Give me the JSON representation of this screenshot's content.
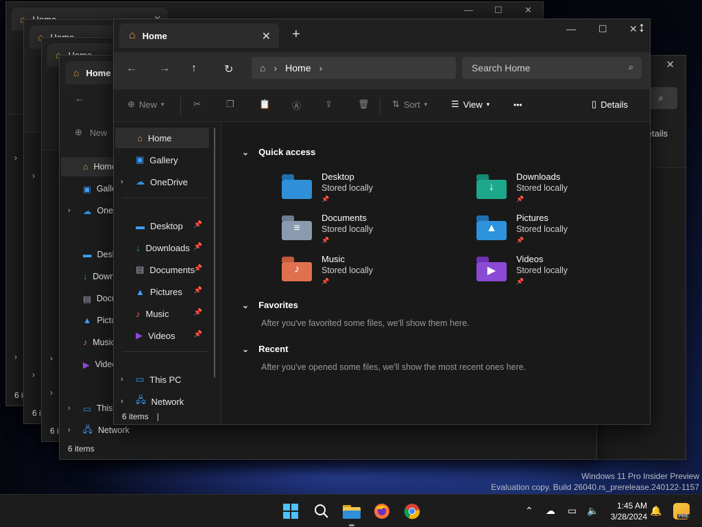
{
  "desktop": {
    "watermark_line1": "Windows 11 Pro Insider Preview",
    "watermark_line2": "Evaluation copy. Build 26040.rs_prerelease.240122-1157"
  },
  "background_windows": [
    {
      "tab_title": "Home",
      "status": "6 items"
    },
    {
      "tab_title": "Home",
      "status": "6 items"
    },
    {
      "tab_title": "Home",
      "status": "6 items"
    },
    {
      "tab_title": "Home",
      "status": "6 items",
      "new_label": "New",
      "nav": [
        "Home",
        "Gallery",
        "OneDrive",
        "Desktop",
        "Downloads",
        "Documents",
        "Pictures",
        "Music",
        "Videos",
        "This PC",
        "Network"
      ]
    }
  ],
  "main": {
    "tab_title": "Home",
    "breadcrumb": [
      "Home"
    ],
    "search_placeholder": "Search Home",
    "commands": {
      "new": "New",
      "sort": "Sort",
      "view": "View",
      "more": "•••",
      "details": "Details"
    },
    "nav": {
      "home": "Home",
      "gallery": "Gallery",
      "onedrive": "OneDrive",
      "desktop": "Desktop",
      "downloads": "Downloads",
      "documents": "Documents",
      "pictures": "Pictures",
      "music": "Music",
      "videos": "Videos",
      "thispc": "This PC",
      "network": "Network"
    },
    "status": "6 items",
    "sections": {
      "quick_access": "Quick access",
      "favorites": "Favorites",
      "favorites_empty": "After you've favorited some files, we'll show them here.",
      "recent": "Recent",
      "recent_empty": "After you've opened some files, we'll show the most recent ones here."
    },
    "quick_access": [
      {
        "name": "Desktop",
        "sub": "Stored locally",
        "color": "#2f8fd8"
      },
      {
        "name": "Downloads",
        "sub": "Stored locally",
        "color": "#1ea88b"
      },
      {
        "name": "Documents",
        "sub": "Stored locally",
        "color": "#8a9bb0"
      },
      {
        "name": "Pictures",
        "sub": "Stored locally",
        "color": "#2d92dc"
      },
      {
        "name": "Music",
        "sub": "Stored locally",
        "color": "#e0714f"
      },
      {
        "name": "Videos",
        "sub": "Stored locally",
        "color": "#8b4ad6"
      }
    ]
  },
  "taskbar": {
    "time": "1:45 AM",
    "date": "3/28/2024",
    "apps": [
      "start-icon",
      "search-icon",
      "file-explorer-icon",
      "firefox-icon",
      "chrome-icon"
    ]
  }
}
